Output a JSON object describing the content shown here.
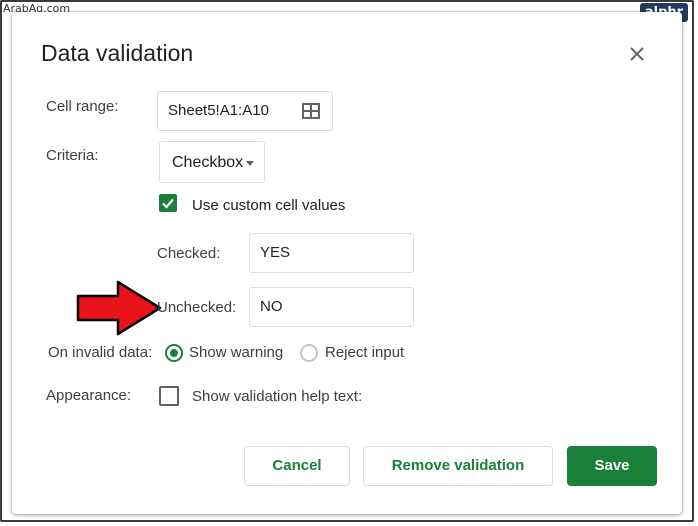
{
  "watermark": "ArabAq.com",
  "brand": "alphr",
  "dialog": {
    "title": "Data validation",
    "cell_range": {
      "label": "Cell range:",
      "value": "Sheet5!A1:A10"
    },
    "criteria": {
      "label": "Criteria:",
      "selected": "Checkbox"
    },
    "custom_values": {
      "label": "Use custom cell values",
      "checked": true
    },
    "checked_field": {
      "label": "Checked:",
      "value": "YES"
    },
    "unchecked_field": {
      "label": "Unchecked:",
      "value": "NO"
    },
    "invalid_data": {
      "label": "On invalid data:",
      "options": [
        "Show warning",
        "Reject input"
      ],
      "selected": "Show warning"
    },
    "appearance": {
      "label": "Appearance:",
      "checkbox_label": "Show validation help text:",
      "checked": false
    },
    "buttons": {
      "cancel": "Cancel",
      "remove": "Remove validation",
      "save": "Save"
    }
  },
  "colors": {
    "accent": "#188038",
    "annotation_arrow": "#e8131b"
  }
}
